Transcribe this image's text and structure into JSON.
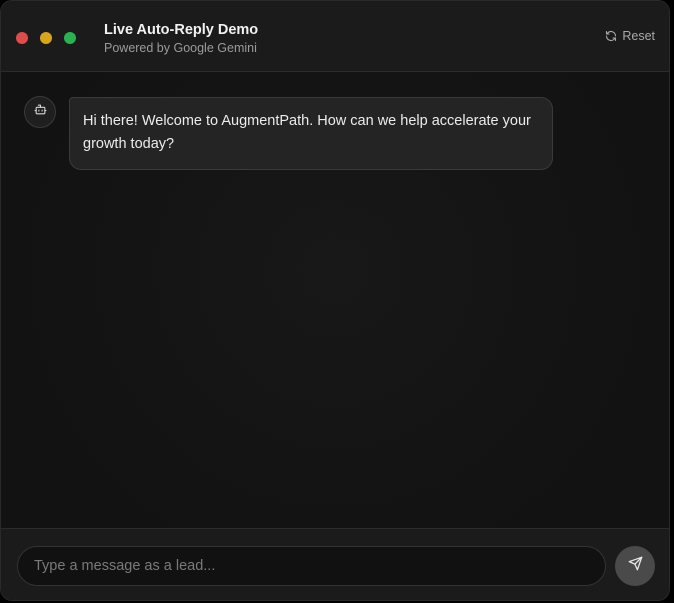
{
  "window": {
    "title": "Live Auto-Reply Demo",
    "subtitle": "Powered by Google Gemini",
    "reset_label": "Reset",
    "controls": [
      "close",
      "minimize",
      "maximize"
    ]
  },
  "chat": {
    "messages": [
      {
        "sender": "bot",
        "avatar_icon": "bot-icon",
        "text": "Hi there! Welcome to AugmentPath. How can we help accelerate your growth today?"
      }
    ]
  },
  "composer": {
    "placeholder": "Type a message as a lead...",
    "value": "",
    "send_icon": "send-icon"
  },
  "colors": {
    "close": "#e04b4b",
    "minimize": "#d9a51c",
    "maximize": "#29b24f",
    "background": "#131313",
    "bubble": "#242424",
    "send_button": "#4a4a4a"
  }
}
